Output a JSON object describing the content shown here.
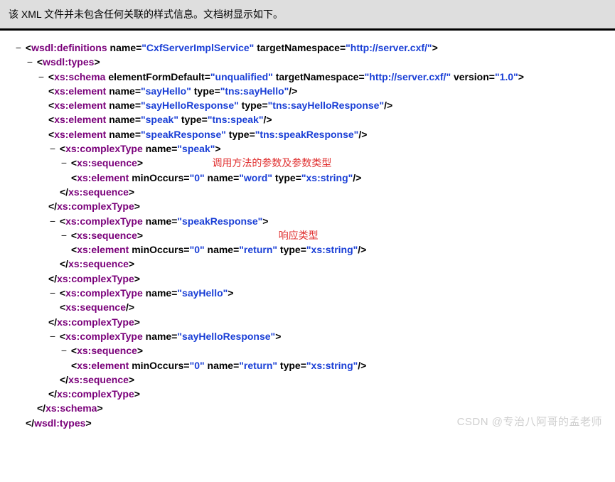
{
  "header": {
    "message": "该 XML 文件并未包含任何关联的样式信息。文档树显示如下。"
  },
  "toggle": "−",
  "punct": {
    "lt": "<",
    "gt": ">",
    "sc": "/>",
    "ct": "</",
    "eq": "="
  },
  "tags": {
    "definitions": "wsdl:definitions",
    "types": "wsdl:types",
    "schema": "xs:schema",
    "element": "xs:element",
    "complexType": "xs:complexType",
    "sequence": "xs:sequence"
  },
  "attrs": {
    "name": "name",
    "targetNamespace": "targetNamespace",
    "elementFormDefault": "elementFormDefault",
    "version": "version",
    "type": "type",
    "minOccurs": "minOccurs"
  },
  "vals": {
    "serviceName": "\"CxfServerImplService\"",
    "ns": "\"http://server.cxf/\"",
    "unqualified": "\"unqualified\"",
    "version": "\"1.0\"",
    "sayHello": "\"sayHello\"",
    "tnsSayHello": "\"tns:sayHello\"",
    "sayHelloResponse": "\"sayHelloResponse\"",
    "tnsSayHelloResponse": "\"tns:sayHelloResponse\"",
    "speak": "\"speak\"",
    "tnsSpeak": "\"tns:speak\"",
    "speakResponse": "\"speakResponse\"",
    "tnsSpeakResponse": "\"tns:speakResponse\"",
    "zero": "\"0\"",
    "word": "\"word\"",
    "xsString": "\"xs:string\"",
    "ret": "\"return\""
  },
  "notes": {
    "param": "调用方法的参数及参数类型",
    "resp": "响应类型"
  },
  "watermark": "CSDN @专治八阿哥的孟老师"
}
